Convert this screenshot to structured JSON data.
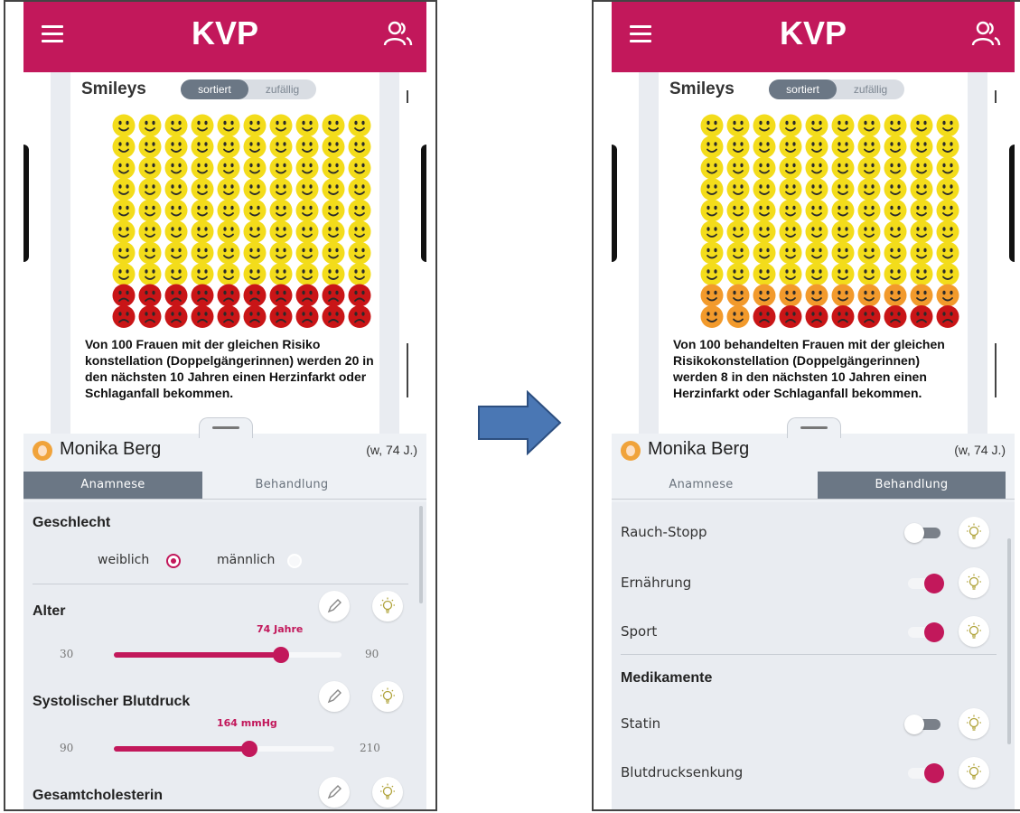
{
  "colors": {
    "brand": "#c2185b",
    "smiley_yellow": "#f3dc1b",
    "smiley_orange": "#f29a2c",
    "smiley_red": "#c91517"
  },
  "left_screen": {
    "app_title": "KVP",
    "card": {
      "title": "Smileys",
      "toggle": {
        "sorted_label": "sortiert",
        "random_label": "zufällig",
        "selected": "sortiert"
      },
      "smileys": {
        "total": 100,
        "columns": 10,
        "happy": 80,
        "neutral": 0,
        "sad": 20
      },
      "caption": "Von 100 Frauen mit der gleichen Risiko konstellation (Doppelgängerinnen) werden 20 in den nächsten 10 Jahren einen Herzinfarkt oder Schlaganfall bekommen."
    },
    "patient": {
      "name": "Monika Berg",
      "info": "(w, 74 J.)"
    },
    "tabs": [
      {
        "label": "Anamnese",
        "active": true
      },
      {
        "label": "Behandlung",
        "active": false
      }
    ],
    "anamnese": {
      "geschlecht": {
        "title": "Geschlecht",
        "female_label": "weiblich",
        "male_label": "männlich",
        "selected": "weiblich"
      },
      "alter": {
        "title": "Alter",
        "value_label": "74 Jahre",
        "min": "30",
        "max": "90",
        "value": 74,
        "min_value": 30,
        "max_value": 90
      },
      "blutdruck": {
        "title": "Systolischer Blutdruck",
        "value_label": "164 mmHg",
        "min": "90",
        "max": "210",
        "value": 164,
        "min_value": 90,
        "max_value": 210
      },
      "cholesterin": {
        "title": "Gesamtcholesterin"
      }
    }
  },
  "right_screen": {
    "app_title": "KVP",
    "card": {
      "title": "Smileys",
      "toggle": {
        "sorted_label": "sortiert",
        "random_label": "zufällig",
        "selected": "sortiert"
      },
      "smileys": {
        "total": 100,
        "columns": 10,
        "happy": 80,
        "neutral": 12,
        "sad": 8
      },
      "caption": "Von 100 behandelten Frauen mit der gleichen Risikokonstellation (Doppelgängerinnen) werden 8 in den nächsten 10 Jahren einen Herzinfarkt oder Schlaganfall bekommen."
    },
    "patient": {
      "name": "Monika Berg",
      "info": "(w, 74 J.)"
    },
    "tabs": [
      {
        "label": "Anamnese",
        "active": false
      },
      {
        "label": "Behandlung",
        "active": true
      }
    ],
    "behandlung": {
      "rows": [
        {
          "label": "Rauch-Stopp",
          "on": false
        },
        {
          "label": "Ernährung",
          "on": true
        },
        {
          "label": "Sport",
          "on": true
        }
      ],
      "medikamente_title": "Medikamente",
      "med_rows": [
        {
          "label": "Statin",
          "on": false
        },
        {
          "label": "Blutdrucksenkung",
          "on": true
        }
      ]
    }
  }
}
